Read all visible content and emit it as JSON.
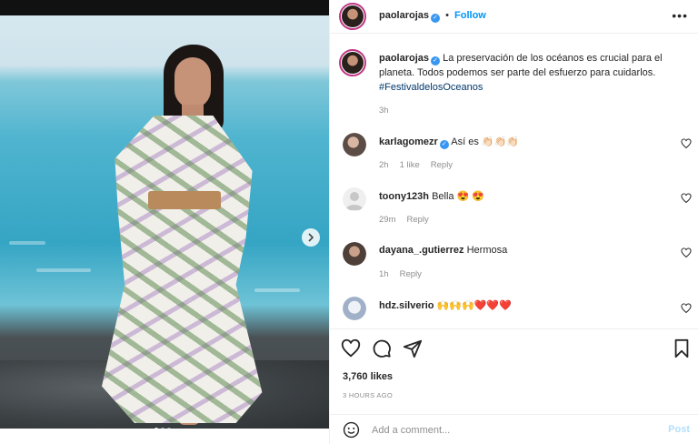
{
  "post": {
    "username": "paolarojas",
    "separator": "•",
    "follow_label": "Follow",
    "more_label": "•••",
    "caption": {
      "username": "paolarojas",
      "text": "La preservación de los océanos es crucial para el planeta. Todos podemos ser parte del esfuerzo para cuidarlos.",
      "hashtag": "#FestivaldelosOceanos",
      "time": "3h"
    },
    "carousel": {
      "current": 1,
      "total": 3,
      "next_icon": "chevron-right-icon"
    }
  },
  "comments": [
    {
      "username": "karlagomezr",
      "verified": true,
      "text": "Así es",
      "emojis": "👏🏻👏🏻👏🏻",
      "time": "2h",
      "likes": "1 like",
      "reply": "Reply",
      "avatar_color": "#6b5a55"
    },
    {
      "username": "toony123h",
      "verified": false,
      "text": "Bella",
      "emojis": "😍 😍",
      "time": "29m",
      "likes": "",
      "reply": "Reply",
      "avatar_color": "#dbdbdb"
    },
    {
      "username": "dayana_.gutierrez",
      "verified": false,
      "text": "Hermosa",
      "emojis": "",
      "time": "1h",
      "likes": "",
      "reply": "Reply",
      "avatar_color": "#7a6a5c"
    },
    {
      "username": "hdz.silverio",
      "verified": false,
      "text": "",
      "emojis": "🙌🙌🙌❤️❤️❤️",
      "time": "",
      "likes": "",
      "reply": "",
      "avatar_color": "#c9d3e0"
    }
  ],
  "actions": {
    "likes": "3,760 likes",
    "time_ago": "3 HOURS AGO"
  },
  "add_comment": {
    "placeholder": "Add a comment...",
    "post_label": "Post"
  },
  "colors": {
    "accent": "#0095f6",
    "verified": "#3897f0",
    "muted": "#8e8e8e",
    "hashtag": "#00376b"
  }
}
